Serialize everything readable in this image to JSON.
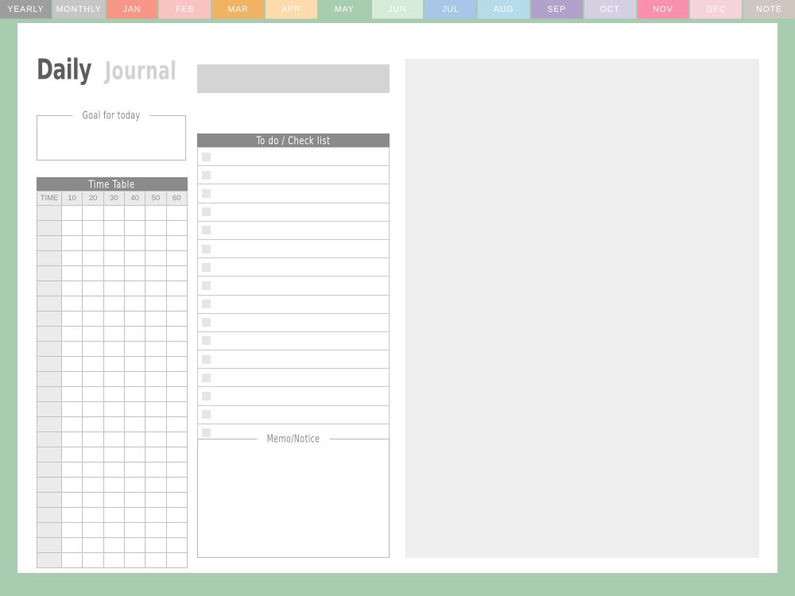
{
  "app": {
    "background_color": "#a8ccb0",
    "page_background": "#ffffff"
  },
  "tabbar": {
    "active_tab": "MAY",
    "tabs": [
      {
        "label": "YEARLY",
        "color": "#9e9e9e"
      },
      {
        "label": "MONTHLY",
        "color": "#c6c6c6"
      },
      {
        "label": "JAN",
        "color": "#f79686"
      },
      {
        "label": "FEB",
        "color": "#f8c3c0"
      },
      {
        "label": "MAR",
        "color": "#efb363"
      },
      {
        "label": "APR",
        "color": "#fcdcad"
      },
      {
        "label": "MAY",
        "color": "#a8ccb0"
      },
      {
        "label": "JUN",
        "color": "#d6ecd9"
      },
      {
        "label": "JUL",
        "color": "#a8c6e8"
      },
      {
        "label": "AUG",
        "color": "#b6dcea"
      },
      {
        "label": "SEP",
        "color": "#b0a2ca"
      },
      {
        "label": "OCT",
        "color": "#d5cfe2"
      },
      {
        "label": "NOV",
        "color": "#f890ae"
      },
      {
        "label": "DEC",
        "color": "#f6d2da"
      },
      {
        "label": "NOTE",
        "color": "#cdc7c0"
      }
    ]
  },
  "header": {
    "title_primary": "Daily",
    "title_secondary": "Journal",
    "date_field": {
      "value": "",
      "placeholder": ""
    }
  },
  "goal": {
    "label": "Goal for today",
    "value": ""
  },
  "time_table": {
    "header": "Time Table",
    "columns": [
      "TIME",
      "10",
      "20",
      "30",
      "40",
      "50",
      "60"
    ],
    "row_count": 24,
    "rows": [
      {
        "time": "",
        "cells": [
          "",
          "",
          "",
          "",
          "",
          ""
        ]
      },
      {
        "time": "",
        "cells": [
          "",
          "",
          "",
          "",
          "",
          ""
        ]
      },
      {
        "time": "",
        "cells": [
          "",
          "",
          "",
          "",
          "",
          ""
        ]
      },
      {
        "time": "",
        "cells": [
          "",
          "",
          "",
          "",
          "",
          ""
        ]
      },
      {
        "time": "",
        "cells": [
          "",
          "",
          "",
          "",
          "",
          ""
        ]
      },
      {
        "time": "",
        "cells": [
          "",
          "",
          "",
          "",
          "",
          ""
        ]
      },
      {
        "time": "",
        "cells": [
          "",
          "",
          "",
          "",
          "",
          ""
        ]
      },
      {
        "time": "",
        "cells": [
          "",
          "",
          "",
          "",
          "",
          ""
        ]
      },
      {
        "time": "",
        "cells": [
          "",
          "",
          "",
          "",
          "",
          ""
        ]
      },
      {
        "time": "",
        "cells": [
          "",
          "",
          "",
          "",
          "",
          ""
        ]
      },
      {
        "time": "",
        "cells": [
          "",
          "",
          "",
          "",
          "",
          ""
        ]
      },
      {
        "time": "",
        "cells": [
          "",
          "",
          "",
          "",
          "",
          ""
        ]
      },
      {
        "time": "",
        "cells": [
          "",
          "",
          "",
          "",
          "",
          ""
        ]
      },
      {
        "time": "",
        "cells": [
          "",
          "",
          "",
          "",
          "",
          ""
        ]
      },
      {
        "time": "",
        "cells": [
          "",
          "",
          "",
          "",
          "",
          ""
        ]
      },
      {
        "time": "",
        "cells": [
          "",
          "",
          "",
          "",
          "",
          ""
        ]
      },
      {
        "time": "",
        "cells": [
          "",
          "",
          "",
          "",
          "",
          ""
        ]
      },
      {
        "time": "",
        "cells": [
          "",
          "",
          "",
          "",
          "",
          ""
        ]
      },
      {
        "time": "",
        "cells": [
          "",
          "",
          "",
          "",
          "",
          ""
        ]
      },
      {
        "time": "",
        "cells": [
          "",
          "",
          "",
          "",
          "",
          ""
        ]
      },
      {
        "time": "",
        "cells": [
          "",
          "",
          "",
          "",
          "",
          ""
        ]
      },
      {
        "time": "",
        "cells": [
          "",
          "",
          "",
          "",
          "",
          ""
        ]
      },
      {
        "time": "",
        "cells": [
          "",
          "",
          "",
          "",
          "",
          ""
        ]
      },
      {
        "time": "",
        "cells": [
          "",
          "",
          "",
          "",
          "",
          ""
        ]
      }
    ]
  },
  "todo": {
    "header": "To do / Check list",
    "item_count": 16,
    "items": [
      {
        "checked": false,
        "text": ""
      },
      {
        "checked": false,
        "text": ""
      },
      {
        "checked": false,
        "text": ""
      },
      {
        "checked": false,
        "text": ""
      },
      {
        "checked": false,
        "text": ""
      },
      {
        "checked": false,
        "text": ""
      },
      {
        "checked": false,
        "text": ""
      },
      {
        "checked": false,
        "text": ""
      },
      {
        "checked": false,
        "text": ""
      },
      {
        "checked": false,
        "text": ""
      },
      {
        "checked": false,
        "text": ""
      },
      {
        "checked": false,
        "text": ""
      },
      {
        "checked": false,
        "text": ""
      },
      {
        "checked": false,
        "text": ""
      },
      {
        "checked": false,
        "text": ""
      },
      {
        "checked": false,
        "text": ""
      }
    ]
  },
  "memo": {
    "label": "Memo/Notice",
    "value": ""
  },
  "right_panel": {
    "value": "",
    "color": "#eeeeee"
  }
}
